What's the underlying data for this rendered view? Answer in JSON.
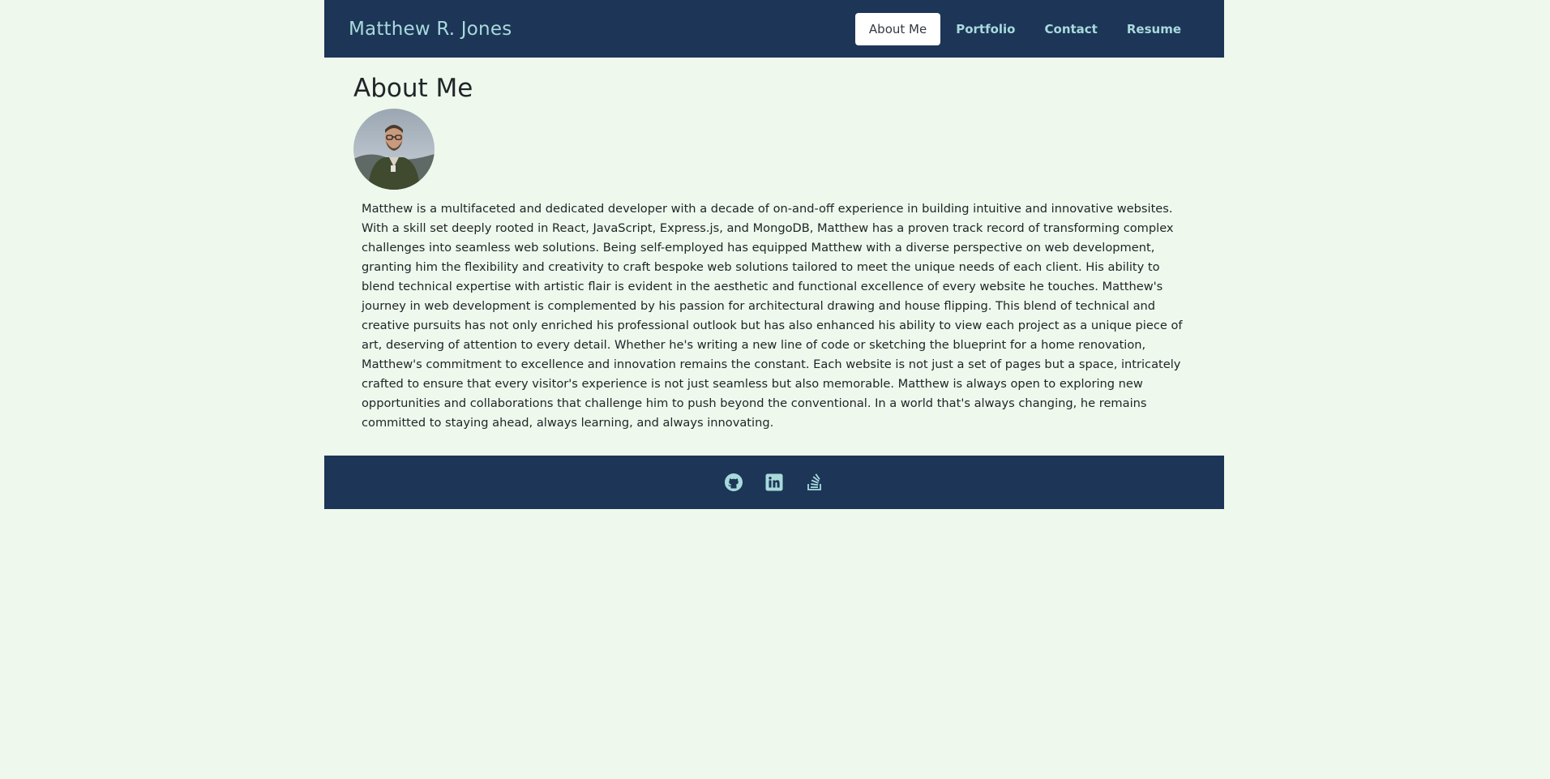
{
  "header": {
    "brand": "Matthew R. Jones",
    "nav": [
      {
        "label": "About Me",
        "active": true
      },
      {
        "label": "Portfolio",
        "active": false
      },
      {
        "label": "Contact",
        "active": false
      },
      {
        "label": "Resume",
        "active": false
      }
    ]
  },
  "main": {
    "title": "About Me",
    "bio": "Matthew is a multifaceted and dedicated developer with a decade of on-and-off experience in building intuitive and innovative websites. With a skill set deeply rooted in React, JavaScript, Express.js, and MongoDB, Matthew has a proven track record of transforming complex challenges into seamless web solutions. Being self-employed has equipped Matthew with a diverse perspective on web development, granting him the flexibility and creativity to craft bespoke web solutions tailored to meet the unique needs of each client. His ability to blend technical expertise with artistic flair is evident in the aesthetic and functional excellence of every website he touches. Matthew's journey in web development is complemented by his passion for architectural drawing and house flipping. This blend of technical and creative pursuits has not only enriched his professional outlook but has also enhanced his ability to view each project as a unique piece of art, deserving of attention to every detail. Whether he's writing a new line of code or sketching the blueprint for a home renovation, Matthew's commitment to excellence and innovation remains the constant. Each website is not just a set of pages but a space, intricately crafted to ensure that every visitor's experience is not just seamless but also memorable. Matthew is always open to exploring new opportunities and collaborations that challenge him to push beyond the conventional. In a world that's always changing, he remains committed to staying ahead, always learning, and always innovating."
  },
  "footer": {
    "icons": [
      "github-icon",
      "linkedin-icon",
      "stackoverflow-icon"
    ]
  },
  "colors": {
    "background": "#eef8ec",
    "bar": "#1d3557",
    "accent": "#a8dadc"
  }
}
